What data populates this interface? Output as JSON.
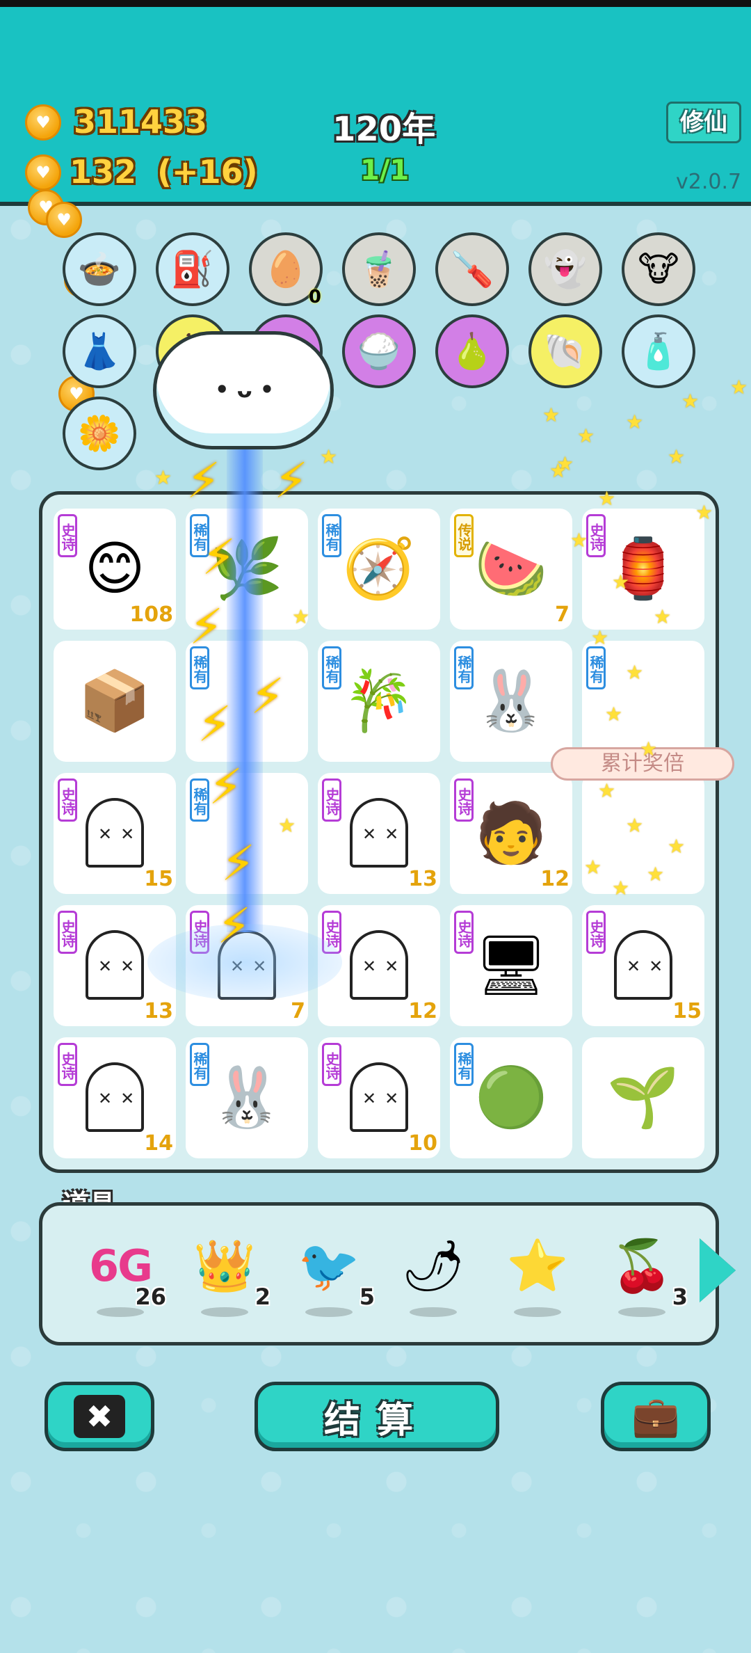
{
  "header": {
    "coins": "311433",
    "income": "132",
    "income_delta": "(+16)",
    "year": "120年",
    "progress": "1/1",
    "cultivate_button": "修仙",
    "version": "v2.0.7"
  },
  "collection": {
    "row1": [
      {
        "name": "rice-cooker-icon",
        "glyph": "🍲",
        "style": "blue"
      },
      {
        "name": "pump-icon",
        "glyph": "⛽",
        "style": "blue"
      },
      {
        "name": "egg-tray-icon",
        "glyph": "🥚",
        "style": "gray",
        "badge": "0"
      },
      {
        "name": "milk-tea-icon",
        "glyph": "🧋",
        "style": "gray"
      },
      {
        "name": "screwdriver-icon",
        "glyph": "🪛",
        "style": "gray"
      },
      {
        "name": "ghost-icon",
        "glyph": "👻",
        "style": "gray"
      },
      {
        "name": "cows-icon",
        "glyph": "🐮",
        "style": "gray"
      }
    ],
    "row2": [
      {
        "name": "skirt-icon",
        "glyph": "👗",
        "style": "blue"
      },
      {
        "name": "fruit-bowl-icon",
        "glyph": "🍎",
        "style": "yellow"
      },
      {
        "name": "math-icon",
        "glyph": "✖",
        "style": "purple"
      },
      {
        "name": "rice-bowl-icon",
        "glyph": "🍚",
        "style": "purple"
      },
      {
        "name": "pomelo-icon",
        "glyph": "🍐",
        "style": "purple"
      },
      {
        "name": "shell-icon",
        "glyph": "🐚",
        "style": "yellow"
      },
      {
        "name": "bottle-icon",
        "glyph": "🧴",
        "style": "blue"
      }
    ],
    "row3": [
      {
        "name": "potted-flower-icon",
        "glyph": "🌼",
        "style": "blue"
      }
    ]
  },
  "board": {
    "bonus_label": "累计奖倍",
    "cells": [
      {
        "tag": "史诗",
        "tag_style": "epic",
        "art": "😊",
        "count": "108",
        "name": "cell-yellow-chick"
      },
      {
        "tag": "稀有",
        "tag_style": "rare",
        "art": "🌿",
        "count": "",
        "name": "cell-plant"
      },
      {
        "tag": "稀有",
        "tag_style": "rare",
        "art": "🧭",
        "count": "",
        "name": "cell-fan-gauge"
      },
      {
        "tag": "传说",
        "tag_style": "legend",
        "art": "🍉",
        "count": "7",
        "name": "cell-watermelon"
      },
      {
        "tag": "史诗",
        "tag_style": "epic",
        "art": "🏮",
        "count": "",
        "name": "cell-lantern-box"
      },
      {
        "tag": "",
        "tag_style": "",
        "art": "📦",
        "count": "",
        "name": "cell-package"
      },
      {
        "tag": "稀有",
        "tag_style": "rare",
        "art": "",
        "count": "",
        "name": "cell-hidden-1"
      },
      {
        "tag": "稀有",
        "tag_style": "rare",
        "art": "🎋",
        "count": "",
        "name": "cell-bamboo"
      },
      {
        "tag": "稀有",
        "tag_style": "rare",
        "art": "🐰",
        "count": "",
        "name": "cell-rabbit"
      },
      {
        "tag": "稀有",
        "tag_style": "rare",
        "art": "",
        "count": "",
        "name": "cell-hidden-2"
      },
      {
        "tag": "史诗",
        "tag_style": "epic",
        "art": "ghost",
        "count": "15",
        "name": "cell-ghost"
      },
      {
        "tag": "稀有",
        "tag_style": "rare",
        "art": "",
        "count": "",
        "name": "cell-hidden-3"
      },
      {
        "tag": "史诗",
        "tag_style": "epic",
        "art": "ghost",
        "count": "13",
        "name": "cell-ghost"
      },
      {
        "tag": "史诗",
        "tag_style": "epic",
        "art": "🧑",
        "count": "12",
        "name": "cell-green-cap-man"
      },
      {
        "tag": "",
        "tag_style": "",
        "art": "",
        "count": "",
        "name": "cell-hidden-4"
      },
      {
        "tag": "史诗",
        "tag_style": "epic",
        "art": "ghost",
        "count": "13",
        "name": "cell-ghost"
      },
      {
        "tag": "史诗",
        "tag_style": "epic",
        "art": "ghost",
        "count": "7",
        "name": "cell-ghost"
      },
      {
        "tag": "史诗",
        "tag_style": "epic",
        "art": "ghost",
        "count": "12",
        "name": "cell-ghost"
      },
      {
        "tag": "史诗",
        "tag_style": "epic",
        "art": "🖥",
        "count": "",
        "name": "cell-graphics-card"
      },
      {
        "tag": "史诗",
        "tag_style": "epic",
        "art": "ghost",
        "count": "15",
        "name": "cell-ghost"
      },
      {
        "tag": "史诗",
        "tag_style": "epic",
        "art": "ghost",
        "count": "14",
        "name": "cell-ghost"
      },
      {
        "tag": "稀有",
        "tag_style": "rare",
        "art": "🐰",
        "count": "",
        "name": "cell-rabbit"
      },
      {
        "tag": "史诗",
        "tag_style": "epic",
        "art": "ghost",
        "count": "10",
        "name": "cell-ghost"
      },
      {
        "tag": "稀有",
        "tag_style": "rare",
        "art": "🟢",
        "count": "",
        "name": "cell-green-ball"
      },
      {
        "tag": "",
        "tag_style": "",
        "art": "🌱",
        "count": "",
        "name": "cell-sprout"
      }
    ]
  },
  "props": {
    "title": "道具",
    "items": [
      {
        "name": "6g-icon",
        "glyph": "6G",
        "count": "26"
      },
      {
        "name": "crown-icon",
        "glyph": "👑",
        "count": "2"
      },
      {
        "name": "bird-icon",
        "glyph": "🐦",
        "count": "5"
      },
      {
        "name": "chili-icon",
        "glyph": "🌶",
        "count": ""
      },
      {
        "name": "star-icon",
        "glyph": "⭐",
        "count": ""
      },
      {
        "name": "lychee-icon",
        "glyph": "🍒",
        "count": "3"
      }
    ]
  },
  "actions": {
    "settle_label": "结算",
    "close_glyph": "✖",
    "bag_glyph": "💼"
  }
}
